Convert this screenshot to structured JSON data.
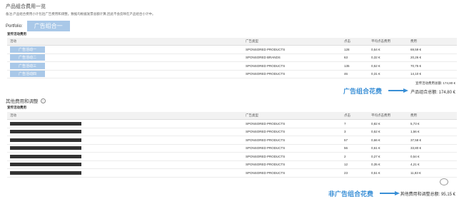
{
  "page": {
    "title": "产品组合费用一览",
    "note": "备注:产品组合费用小计包括广告费用和调整。数据均根据发票总额计算,因此不会反映在产品组合小计中。"
  },
  "portfolio": {
    "label": "Portfolio:",
    "name": "广告组合一"
  },
  "section1": {
    "label": "宣传活动费用",
    "columns": [
      "活动",
      "广告类型",
      "点击",
      "平均点击费用",
      "费用"
    ],
    "rows": [
      {
        "campaign": "广告活动一",
        "type": "SPONSORED PRODUCTS",
        "clicks": "128",
        "cpc": "0,54 €",
        "cost": "69,59 €"
      },
      {
        "campaign": "广告活动二",
        "type": "SPONSORED BRANDS",
        "clicks": "63",
        "cpc": "0,32 €",
        "cost": "20,26 €"
      },
      {
        "campaign": "广告活动三",
        "type": "SPONSORED PRODUCTS",
        "clicks": "135",
        "cpc": "0,52 €",
        "cost": "70,75 €"
      },
      {
        "campaign": "广告活动四",
        "type": "SPONSORED PRODUCTS",
        "clicks": "46",
        "cpc": "0,31 €",
        "cost": "14,10 €"
      }
    ],
    "subtotal": "宣传活动费用总额: 174,80 €",
    "total": "产品组合总额: 174,80 €",
    "annotation": "广告组合花费"
  },
  "section2": {
    "title": "其他费用和调整",
    "label": "宣传活动费用",
    "columns": [
      "活动",
      "广告类型",
      "点击",
      "平均点击费用",
      "费用"
    ],
    "rows": [
      {
        "type": "SPONSORED PRODUCTS",
        "clicks": "7",
        "cpc": "0,82 €",
        "cost": "5,73 €"
      },
      {
        "type": "SPONSORED PRODUCTS",
        "clicks": "3",
        "cpc": "0,52 €",
        "cost": "1,56 €"
      },
      {
        "type": "SPONSORED PRODUCTS",
        "clicks": "57",
        "cpc": "0,66 €",
        "cost": "37,58 €"
      },
      {
        "type": "SPONSORED PRODUCTS",
        "clicks": "56",
        "cpc": "0,61 €",
        "cost": "33,80 €"
      },
      {
        "type": "SPONSORED PRODUCTS",
        "clicks": "2",
        "cpc": "0,27 €",
        "cost": "0,54 €"
      },
      {
        "type": "SPONSORED PRODUCTS",
        "clicks": "12",
        "cpc": "0,35 €",
        "cost": "4,21 €"
      },
      {
        "type": "SPONSORED PRODUCTS",
        "clicks": "23",
        "cpc": "0,51 €",
        "cost": "11,83 €"
      }
    ],
    "total": "其他费用和调整总额: 95,15 €",
    "annotation": "非广告组合花费"
  },
  "colors": {
    "highlight": "#a9c8e8",
    "annotation": "#3a8fd6"
  },
  "icons": {
    "arrow": "arrow-right-icon",
    "help": "help-circle-icon"
  }
}
